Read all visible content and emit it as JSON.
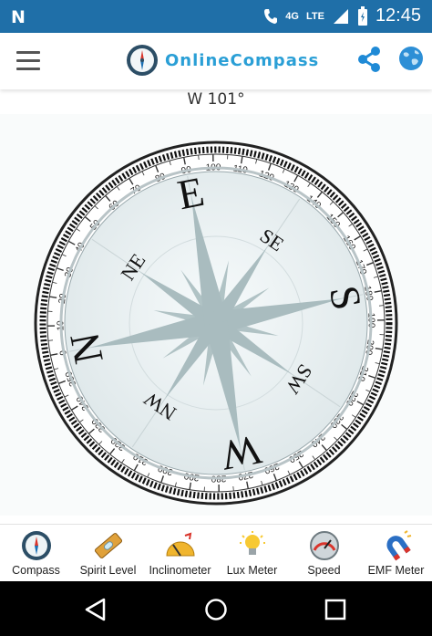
{
  "status_bar": {
    "left_icon": "n-notification-icon",
    "network": "4G",
    "carrier": "LTE",
    "time": "12:45"
  },
  "app_bar": {
    "brand": "OnlineCompass",
    "icons": [
      "menu-icon",
      "compass-logo-icon",
      "share-icon",
      "globe-icon"
    ]
  },
  "heading": "W 101°",
  "compass": {
    "heading_degrees": 101,
    "cardinals": {
      "N": "N",
      "E": "E",
      "S": "S",
      "W": "W"
    },
    "intercardinals": {
      "NE": "NE",
      "SE": "SE",
      "SW": "SW",
      "NW": "NW"
    },
    "colors": {
      "rose": "#a9bcbf",
      "ring": "#111111",
      "face": "#e9f0f2"
    }
  },
  "bottom_nav": [
    {
      "label": "Compass",
      "icon": "compass-icon"
    },
    {
      "label": "Spirit Level",
      "icon": "spirit-level-icon"
    },
    {
      "label": "Inclinometer",
      "icon": "inclinometer-icon"
    },
    {
      "label": "Lux Meter",
      "icon": "lightbulb-icon"
    },
    {
      "label": "Speed",
      "icon": "speedometer-icon"
    },
    {
      "label": "EMF Meter",
      "icon": "magnet-icon"
    }
  ],
  "system_nav": [
    "back-icon",
    "home-icon",
    "recents-icon"
  ]
}
